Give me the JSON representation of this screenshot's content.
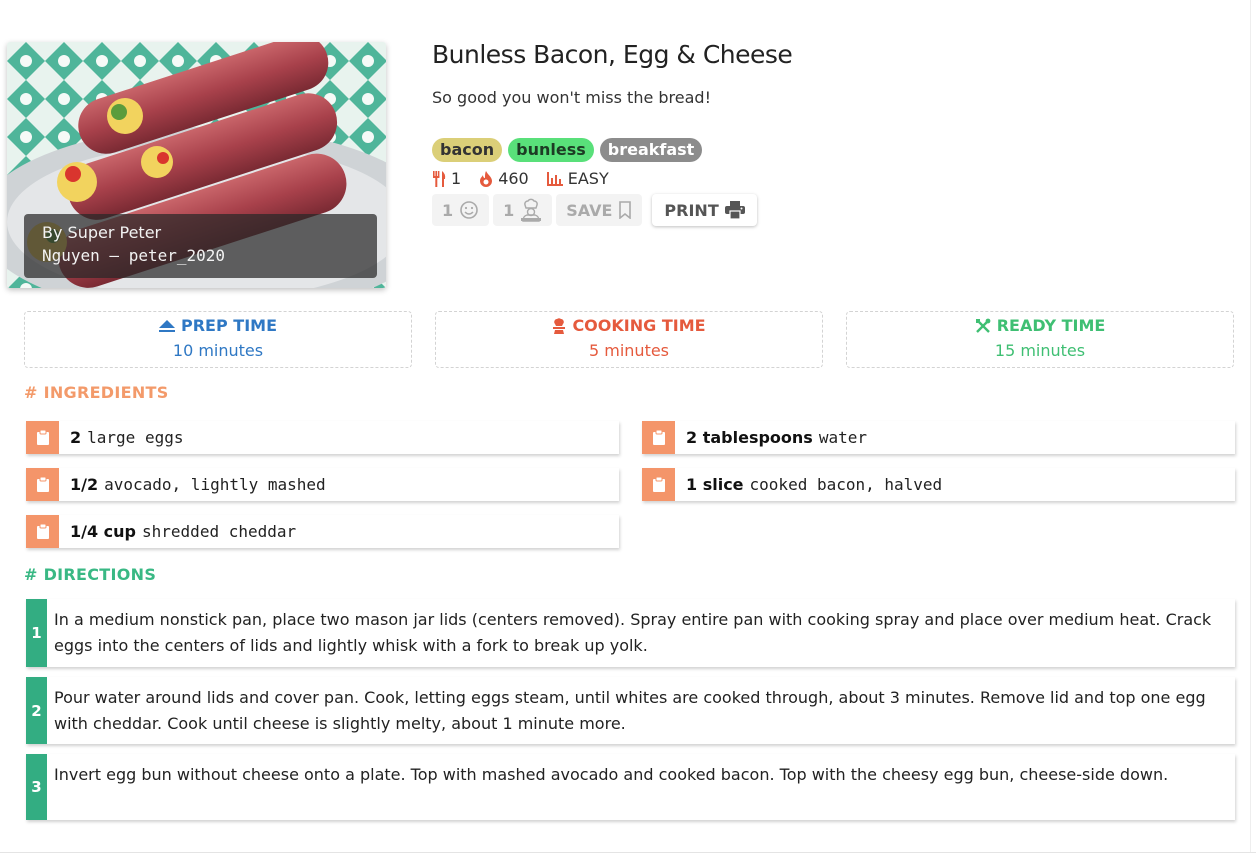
{
  "recipe": {
    "title": "Bunless Bacon, Egg & Cheese",
    "subtitle": "So good you won't miss the bread!",
    "author_line1": "By Super Peter",
    "author_line2": "Nguyen – peter_2020",
    "tags": [
      "bacon",
      "bunless",
      "breakfast"
    ],
    "servings": "1",
    "calories": "460",
    "difficulty": "EASY"
  },
  "actions": {
    "likes_count": "1",
    "cooked_count": "1",
    "save_label": "SAVE",
    "print_label": "PRINT"
  },
  "times": {
    "prep": {
      "label": "PREP TIME",
      "value": "10 minutes"
    },
    "cook": {
      "label": "COOKING TIME",
      "value": "5 minutes"
    },
    "ready": {
      "label": "READY TIME",
      "value": "15 minutes"
    }
  },
  "sections": {
    "ingredients": "# INGREDIENTS",
    "directions": "# DIRECTIONS"
  },
  "ingredients": [
    {
      "qty": "2",
      "name": "large eggs"
    },
    {
      "qty": "2 tablespoons",
      "name": "water"
    },
    {
      "qty": "1/2",
      "name": "avocado, lightly mashed"
    },
    {
      "qty": "1 slice",
      "name": "cooked bacon, halved"
    },
    {
      "qty": "1/4 cup",
      "name": "shredded cheddar"
    }
  ],
  "directions": [
    {
      "num": "1",
      "text": "In a medium nonstick pan, place two mason jar lids (centers removed). Spray entire pan with cooking spray and place over medium heat. Crack eggs into the centers of lids and lightly whisk with a fork to break up yolk."
    },
    {
      "num": "2",
      "text": "Pour water around lids and cover pan. Cook, letting eggs steam, until whites are cooked through, about 3 minutes. Remove lid and top one egg with cheddar. Cook until cheese is slightly melty, about 1 minute more."
    },
    {
      "num": "3",
      "text": "Invert egg bun without cheese onto a plate. Top with mashed avocado and cooked bacon. Top with the cheesy egg bun, cheese-side down."
    }
  ],
  "colors": {
    "prep": "#2f78c4",
    "cook": "#e55a3d",
    "ready": "#3fbf73",
    "ingredients_accent": "#f4956a",
    "directions_accent": "#33ad82"
  },
  "icons": {
    "servings": "utensils-icon",
    "calories": "flame-icon",
    "difficulty": "bar-chart-icon",
    "likes": "smiley-icon",
    "cooked": "chef-icon",
    "save": "bookmark-icon",
    "print": "printer-icon",
    "prep": "eject-icon",
    "cook": "chef-hat-icon",
    "ready": "utensils-cross-icon",
    "ingredient": "clipboard-icon"
  }
}
